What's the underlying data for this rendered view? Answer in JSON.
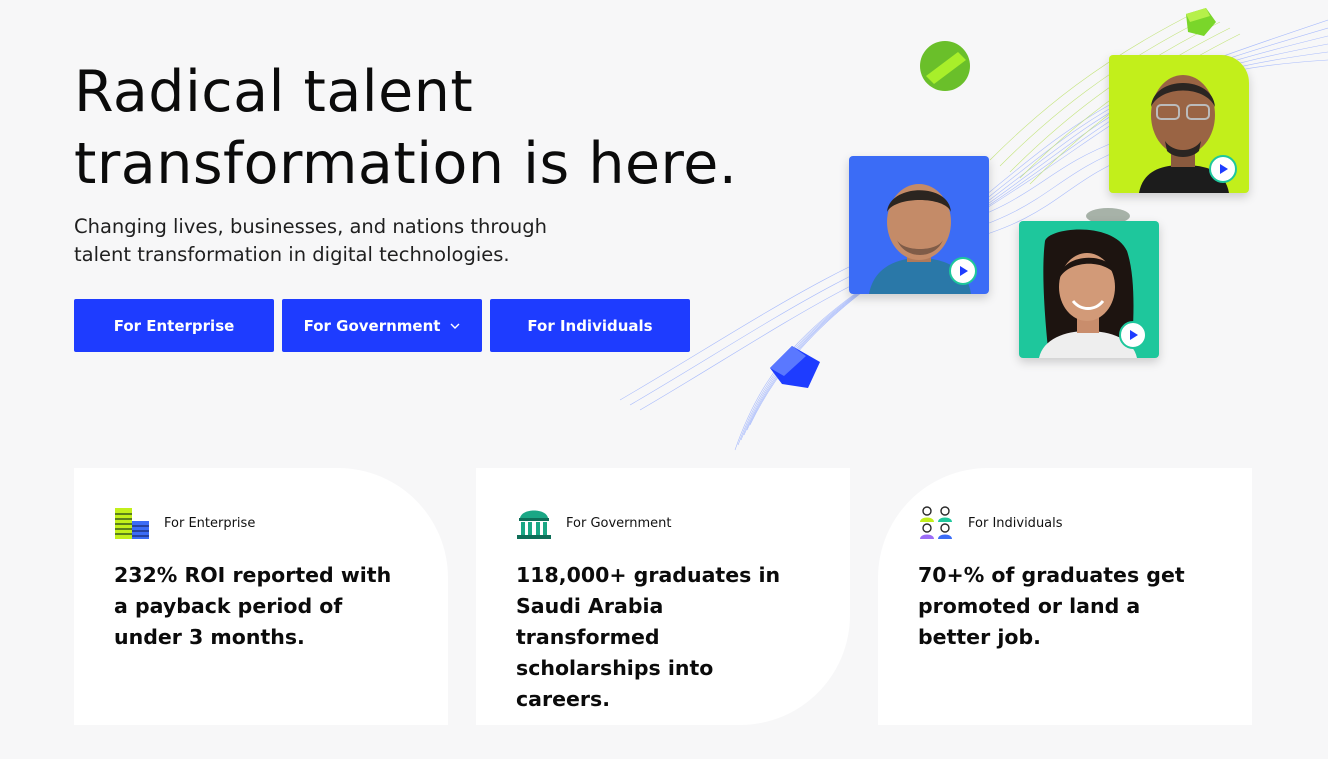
{
  "hero": {
    "title": "Radical talent transformation is here.",
    "subtitle": "Changing lives, businesses, and nations through talent transformation in digital technologies."
  },
  "cta": {
    "enterprise": "For Enterprise",
    "government": "For Government",
    "individuals": "For Individuals"
  },
  "stats": [
    {
      "label": "For Enterprise",
      "text": "232% ROI reported with a payback period of under 3 months.",
      "icon": "building-icon"
    },
    {
      "label": "For Government",
      "text": "118,000+ graduates in Saudi Arabia transformed scholarships into careers.",
      "icon": "government-building-icon"
    },
    {
      "label": "For Individuals",
      "text": "70+% of graduates get promoted or land a better job.",
      "icon": "people-icon"
    }
  ],
  "colors": {
    "accent_blue": "#1e3cff",
    "lime": "#c2ef1b",
    "teal": "#1ec79c",
    "photo_blue": "#3b6cf6",
    "background": "#f7f7f8"
  }
}
